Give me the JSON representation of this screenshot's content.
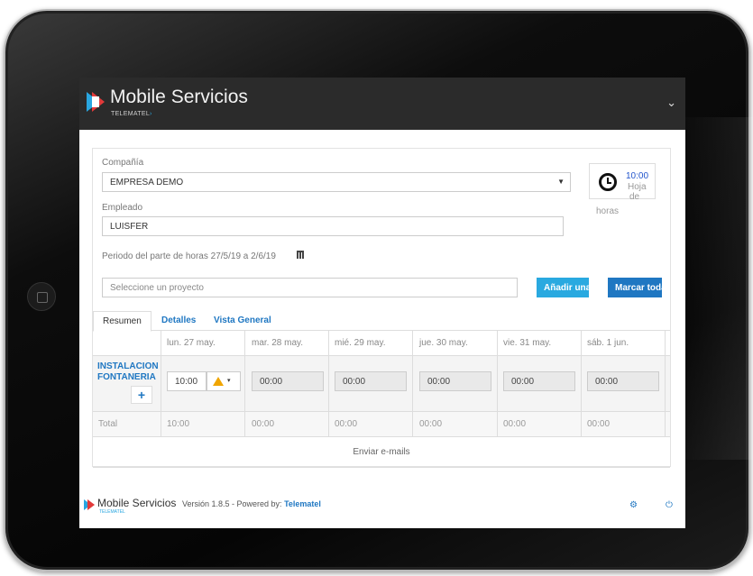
{
  "app": {
    "title": "Mobile Servicios",
    "subtitle": "TELEMATEL",
    "subtitle_arrow": "›"
  },
  "form": {
    "company_label": "Compañía",
    "company_value": "EMPRESA DEMO",
    "employee_label": "Empleado",
    "employee_value": "LUISFER",
    "period_text": "Periodo del parte de horas 27/5/19 a 2/6/19",
    "project_placeholder": "Seleccione un proyecto"
  },
  "clock_widget": {
    "time": "10:00",
    "label_line1": "Hoja",
    "label_line2": "de",
    "label_line3": "horas"
  },
  "buttons": {
    "add_line": "Añadir una l",
    "mark_all": "Marcar toda"
  },
  "tabs": [
    {
      "label": "Resumen",
      "active": true
    },
    {
      "label": "Detalles",
      "active": false
    },
    {
      "label": "Vista General",
      "active": false
    }
  ],
  "timesheet": {
    "days": [
      "lun. 27 may.",
      "mar. 28 may.",
      "mié. 29 may.",
      "jue. 30 may.",
      "vie. 31 may.",
      "sáb. 1 jun."
    ],
    "project_line1": "INSTALACION",
    "project_line2": "FONTANERIA",
    "add_symbol": "+",
    "hours": [
      "10:00",
      "00:00",
      "00:00",
      "00:00",
      "00:00",
      "00:00"
    ],
    "total_label": "Total",
    "totals": [
      "10:00",
      "00:00",
      "00:00",
      "00:00",
      "00:00",
      "00:00"
    ],
    "warning_caret": "▾"
  },
  "send_emails": "Enviar e-mails",
  "footer": {
    "title": "Mobile Servicios",
    "sub": "TELEMATEL",
    "version_text": "Versión 1.8.5 - Powered by:",
    "brand": "Telematel"
  },
  "icons": {
    "header_chevron": "chevron-down-icon",
    "calendar": "calendar-icon",
    "clock": "clock-icon",
    "warning": "warning-icon",
    "settings": "gear-icon",
    "power": "power-icon"
  },
  "colors": {
    "accent_light": "#29a9e0",
    "accent_dark": "#1f77c2",
    "header_bg": "#2b2b2b",
    "warning": "#f0a500"
  }
}
